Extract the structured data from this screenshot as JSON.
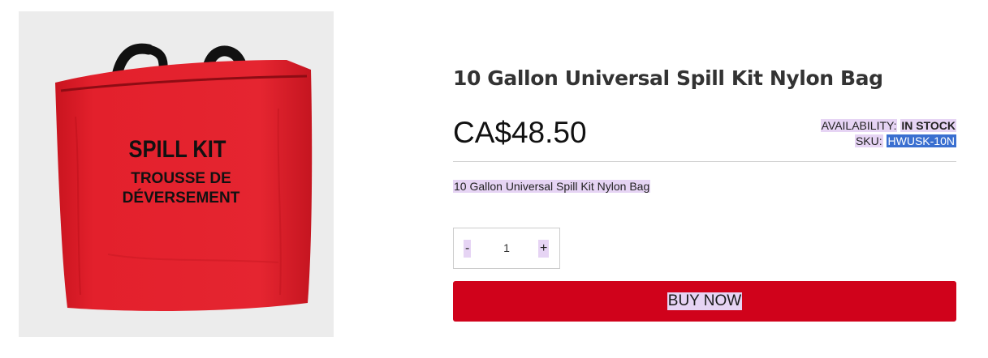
{
  "product": {
    "title": "10 Gallon Universal Spill Kit Nylon Bag",
    "price": "CA$48.50",
    "availability_label": "AVAILABILITY:",
    "availability_value": "IN STOCK",
    "sku_label": "SKU:",
    "sku_value": "HWUSK-10N",
    "description": "10 Gallon Universal Spill Kit Nylon Bag"
  },
  "image": {
    "line1": "SPILL KIT",
    "line2": "TROUSSE DE",
    "line3": "DÉVERSEMENT",
    "bag_color": "#e3202c",
    "handle_color": "#111111"
  },
  "quantity": {
    "minus": "-",
    "value": "1",
    "plus": "+"
  },
  "buy": {
    "label": "BUY NOW",
    "color": "#d0021b"
  }
}
